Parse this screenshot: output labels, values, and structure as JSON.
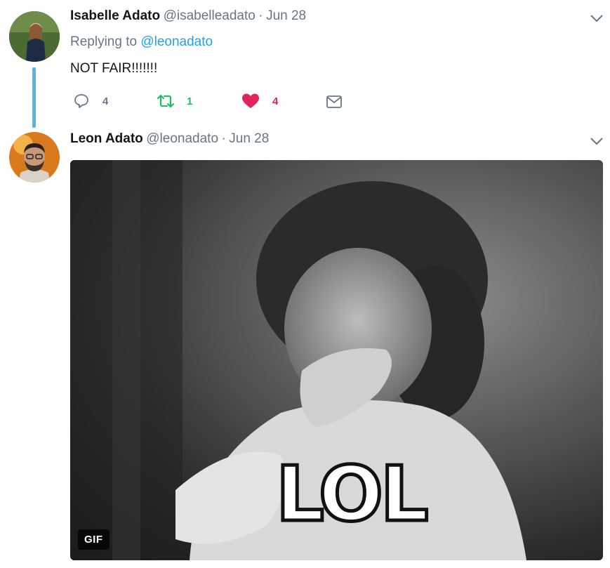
{
  "tweets": [
    {
      "name": "Isabelle Adato",
      "handle": "@isabelleadato",
      "separator": "·",
      "date": "Jun 28",
      "replying_prefix": "Replying to",
      "replying_to": "@leonadato",
      "text": "NOT FAIR!!!!!!!",
      "actions": {
        "reply_count": "4",
        "retweet_count": "1",
        "like_count": "4"
      },
      "icons": [
        "reply-icon",
        "retweet-icon",
        "heart-icon",
        "message-icon",
        "chevron-down-icon"
      ]
    },
    {
      "name": "Leon Adato",
      "handle": "@leonadato",
      "separator": "·",
      "date": "Jun 28",
      "media": {
        "type": "gif",
        "badge": "GIF",
        "overlay_text": "LOL"
      }
    }
  ],
  "colors": {
    "reply": "#657786",
    "retweet": "#17bf63",
    "like": "#e0245e",
    "link": "#1da1f2",
    "thread_line": "#67b0cf"
  }
}
